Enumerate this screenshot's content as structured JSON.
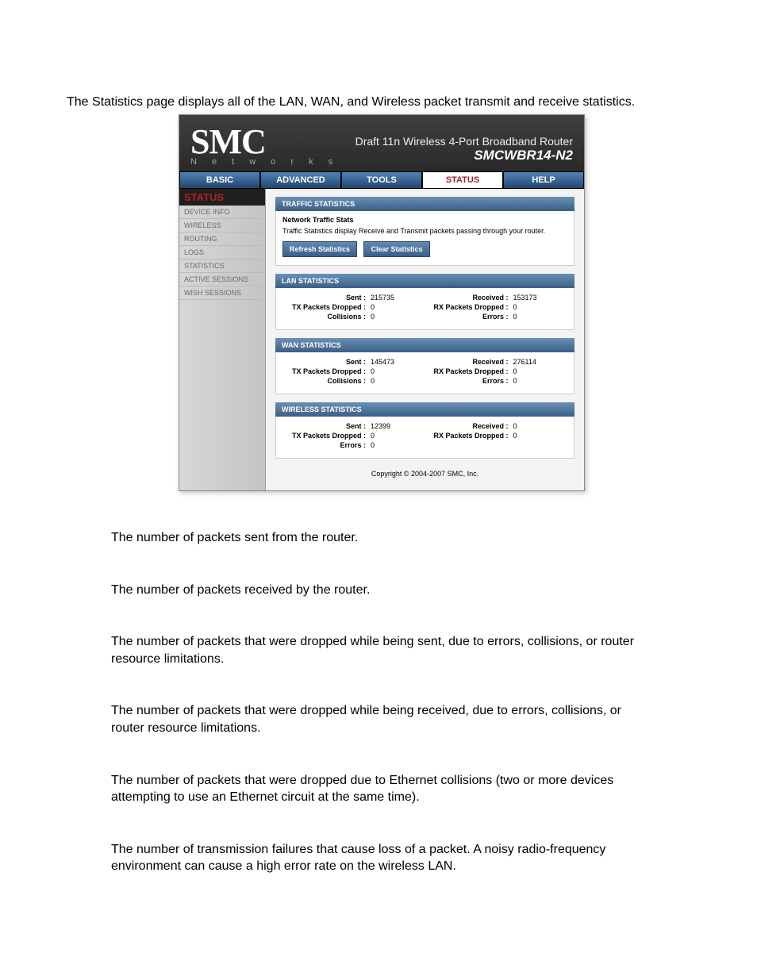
{
  "intro": "The Statistics page displays all of the LAN, WAN, and Wireless packet transmit and receive statistics.",
  "logo": {
    "main": "SMC",
    "sub": "N e t w o r k s"
  },
  "header": {
    "line1": "Draft 11n Wireless 4-Port Broadband Router",
    "line2": "SMCWBR14-N2"
  },
  "nav": {
    "items": [
      "BASIC",
      "ADVANCED",
      "TOOLS",
      "STATUS",
      "HELP"
    ],
    "active": "STATUS"
  },
  "sidebar": {
    "title": "STATUS",
    "items": [
      "DEVICE INFO",
      "WIRELESS",
      "ROUTING",
      "LOGS",
      "STATISTICS",
      "ACTIVE SESSIONS",
      "WISH SESSIONS"
    ]
  },
  "traffic": {
    "head": "TRAFFIC STATISTICS",
    "sub": "Network Traffic Stats",
    "desc": "Traffic Statistics display Receive and Transmit packets passing through your router.",
    "refresh": "Refresh Statistics",
    "clear": "Clear Statistics"
  },
  "lan": {
    "head": "LAN STATISTICS",
    "left": [
      {
        "label": "Sent :",
        "value": "215735"
      },
      {
        "label": "TX Packets Dropped :",
        "value": "0"
      },
      {
        "label": "Collisions :",
        "value": "0"
      }
    ],
    "right": [
      {
        "label": "Received :",
        "value": "153173"
      },
      {
        "label": "RX Packets Dropped :",
        "value": "0"
      },
      {
        "label": "Errors :",
        "value": "0"
      }
    ]
  },
  "wan": {
    "head": "WAN STATISTICS",
    "left": [
      {
        "label": "Sent :",
        "value": "145473"
      },
      {
        "label": "TX Packets Dropped :",
        "value": "0"
      },
      {
        "label": "Collisions :",
        "value": "0"
      }
    ],
    "right": [
      {
        "label": "Received :",
        "value": "276114"
      },
      {
        "label": "RX Packets Dropped :",
        "value": "0"
      },
      {
        "label": "Errors :",
        "value": "0"
      }
    ]
  },
  "wireless": {
    "head": "WIRELESS STATISTICS",
    "left": [
      {
        "label": "Sent :",
        "value": "12399"
      },
      {
        "label": "TX Packets Dropped :",
        "value": "0"
      },
      {
        "label": "Errors :",
        "value": "0"
      }
    ],
    "right": [
      {
        "label": "Received :",
        "value": "0"
      },
      {
        "label": "RX Packets Dropped :",
        "value": "0"
      }
    ]
  },
  "copyright": "Copyright © 2004-2007 SMC, Inc.",
  "defs": [
    "The number of packets sent from the router.",
    "The number of packets received by the router.",
    "The number of packets that were dropped while being sent, due to errors, collisions, or router resource limitations.",
    "The number of packets that were dropped while being received, due to errors, collisions, or router resource limitations.",
    "The number of packets that were dropped due to Ethernet collisions (two or more devices attempting to use an Ethernet circuit at the same time).",
    "The number of transmission failures that cause loss of a packet. A noisy radio-frequency environment can cause a high error rate on the wireless LAN."
  ]
}
